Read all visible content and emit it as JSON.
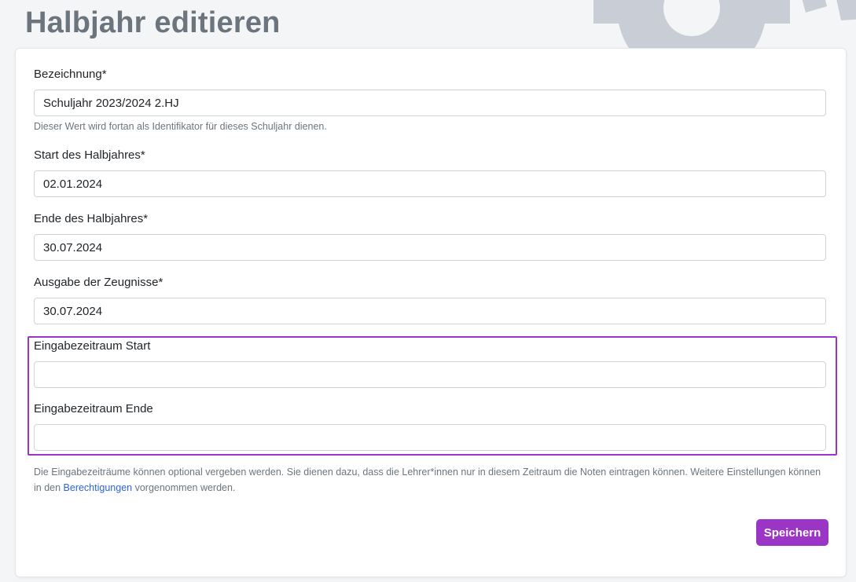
{
  "page": {
    "title": "Halbjahr editieren"
  },
  "form": {
    "bezeichnung": {
      "label": "Bezeichnung*",
      "value": "Schuljahr 2023/2024 2.HJ",
      "help": "Dieser Wert wird fortan als Identifikator für dieses Schuljahr dienen."
    },
    "start": {
      "label": "Start des Halbjahres*",
      "value": "02.01.2024"
    },
    "ende": {
      "label": "Ende des Halbjahres*",
      "value": "30.07.2024"
    },
    "zeugnisse": {
      "label": "Ausgabe der Zeugnisse*",
      "value": "30.07.2024"
    },
    "eingabe_start": {
      "label": "Eingabezeitraum Start",
      "value": ""
    },
    "eingabe_ende": {
      "label": "Eingabezeitraum Ende",
      "value": ""
    },
    "eingabe_help": {
      "before": "Die Eingabezeiträume können optional vergeben werden. Sie dienen dazu, dass die Lehrer*innen nur in diesem Zeitraum die Noten eintragen können. Weitere Einstellungen können in den ",
      "link": "Berechtigungen",
      "after": " vorgenommen werden."
    },
    "save_label": "Speichern"
  },
  "colors": {
    "accent": "#9b35c6",
    "link": "#2c64d9",
    "title": "#6c757d",
    "background_gear": "#c9ced6"
  },
  "icons": {
    "background": "gear-icon"
  }
}
